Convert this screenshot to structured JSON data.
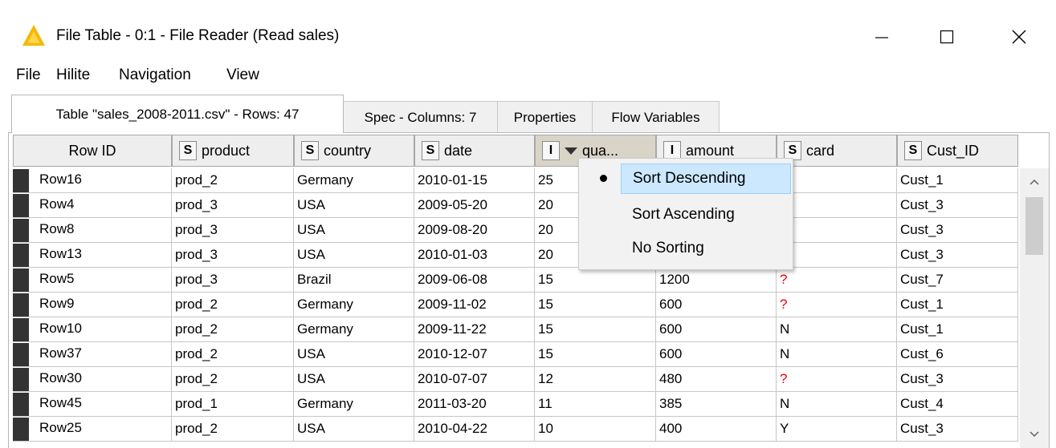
{
  "window": {
    "title": "File Table - 0:1 - File Reader (Read sales)",
    "minimize_icon": "minimize-icon",
    "maximize_icon": "maximize-icon",
    "close_icon": "close-icon"
  },
  "menu": [
    "File",
    "Hilite",
    "Navigation",
    "View"
  ],
  "tabs": [
    "Table \"sales_2008-2011.csv\" - Rows: 47",
    "Spec - Columns: 7",
    "Properties",
    "Flow Variables"
  ],
  "columns": [
    {
      "label": "Row ID",
      "type": ""
    },
    {
      "label": "product",
      "type": "S"
    },
    {
      "label": "country",
      "type": "S"
    },
    {
      "label": "date",
      "type": "S"
    },
    {
      "label": "qua...",
      "type": "I"
    },
    {
      "label": "amount",
      "type": "I"
    },
    {
      "label": "card",
      "type": "S"
    },
    {
      "label": "Cust_ID",
      "type": "S"
    }
  ],
  "rows": [
    [
      "Row16",
      "prod_2",
      "Germany",
      "2010-01-15",
      "25",
      "",
      "",
      "Cust_1"
    ],
    [
      "Row4",
      "prod_3",
      "USA",
      "2009-05-20",
      "20",
      "",
      "",
      "Cust_3"
    ],
    [
      "Row8",
      "prod_3",
      "USA",
      "2009-08-20",
      "20",
      "",
      "",
      "Cust_3"
    ],
    [
      "Row13",
      "prod_3",
      "USA",
      "2010-01-03",
      "20",
      "",
      "",
      "Cust_3"
    ],
    [
      "Row5",
      "prod_3",
      "Brazil",
      "2009-06-08",
      "15",
      "1200",
      "?",
      "Cust_7"
    ],
    [
      "Row9",
      "prod_2",
      "Germany",
      "2009-11-02",
      "15",
      "600",
      "?",
      "Cust_1"
    ],
    [
      "Row10",
      "prod_2",
      "Germany",
      "2009-11-22",
      "15",
      "600",
      "N",
      "Cust_1"
    ],
    [
      "Row37",
      "prod_2",
      "USA",
      "2010-12-07",
      "15",
      "600",
      "N",
      "Cust_6"
    ],
    [
      "Row30",
      "prod_2",
      "USA",
      "2010-07-07",
      "12",
      "480",
      "?",
      "Cust_3"
    ],
    [
      "Row45",
      "prod_1",
      "Germany",
      "2011-03-20",
      "11",
      "385",
      "N",
      "Cust_4"
    ],
    [
      "Row25",
      "prod_2",
      "USA",
      "2010-04-22",
      "10",
      "400",
      "Y",
      "Cust_3"
    ]
  ],
  "sort_menu": {
    "items": [
      "Sort Descending",
      "Sort Ascending",
      "No Sorting"
    ],
    "selected": "Sort Descending"
  },
  "colors": {
    "missing_value": "#e8000d",
    "selection": "#cce8ff",
    "app_icon": "#f5b800"
  }
}
